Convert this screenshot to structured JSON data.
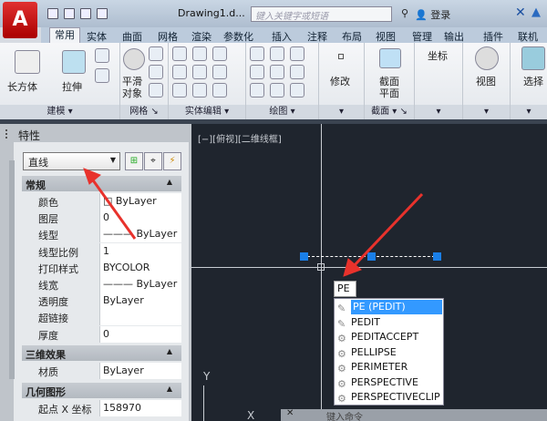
{
  "app": {
    "logo": "A",
    "title": "Drawing1.d...",
    "search_placeholder": "键入关键字或短语",
    "login": "登录"
  },
  "tabs": [
    "常用",
    "实体",
    "曲面",
    "网格",
    "渲染",
    "参数化",
    "插入",
    "注释",
    "布局",
    "视图",
    "管理",
    "输出",
    "插件",
    "联机"
  ],
  "ribbon": {
    "big_buttons": {
      "box": "长方体",
      "extrude": "拉伸",
      "smooth1": "平滑",
      "smooth2": "对象",
      "modify": "修改",
      "section1": "截面",
      "section2": "平面",
      "coords": "坐标",
      "view": "视图",
      "select": "选择"
    },
    "panels": [
      "建模 ▾",
      "网格 ↘",
      "实体编辑 ▾",
      "绘图 ▾",
      "▾",
      "截面 ▾ ↘",
      "▾",
      "▾",
      "▾"
    ]
  },
  "palette": {
    "title": "特性",
    "object_type": "直线",
    "sections": {
      "general": {
        "title": "常规",
        "rows": [
          [
            "颜色",
            "□ ByLayer"
          ],
          [
            "图层",
            "0"
          ],
          [
            "线型",
            "——— ByLayer"
          ],
          [
            "线型比例",
            "1"
          ],
          [
            "打印样式",
            "BYCOLOR"
          ],
          [
            "线宽",
            "——— ByLayer"
          ],
          [
            "透明度",
            "ByLayer"
          ],
          [
            "超链接",
            ""
          ],
          [
            "厚度",
            "0"
          ]
        ]
      },
      "3d": {
        "title": "三维效果",
        "rows": [
          [
            "材质",
            "ByLayer"
          ]
        ]
      },
      "geometry": {
        "title": "几何图形",
        "rows": [
          [
            "起点 X 坐标",
            "158970"
          ]
        ]
      }
    }
  },
  "canvas": {
    "viewport_label": "[−][俯视][二维线框]",
    "command_input": "PE",
    "autocomplete": [
      "PE (PEDIT)",
      "PEDIT",
      "PEDITACCEPT",
      "PELLIPSE",
      "PERIMETER",
      "PERSPECTIVE",
      "PERSPECTIVECLIP"
    ],
    "ucs_y": "Y",
    "ucs_x": "X",
    "command_line_placeholder": "键入命令"
  },
  "colors": {
    "accent": "#1a7fe8",
    "canvas": "#1f252e",
    "arrow": "#e8322c",
    "highlight": "#3399ff"
  }
}
